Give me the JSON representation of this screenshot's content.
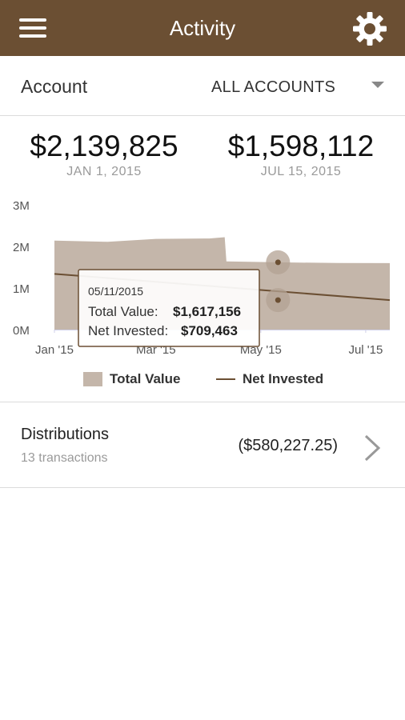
{
  "app_bar": {
    "title": "Activity",
    "menu_icon": "hamburger-menu-icon",
    "settings_icon": "gear-icon",
    "color": "#6b4f33"
  },
  "account": {
    "label": "Account",
    "selected": "ALL ACCOUNTS"
  },
  "summary": {
    "start": {
      "value": "$2,139,825",
      "date": "JAN 1, 2015"
    },
    "end": {
      "value": "$1,598,112",
      "date": "JUL 15, 2015"
    }
  },
  "chart_data": {
    "type": "area",
    "y_ticks": [
      "3M",
      "2M",
      "1M",
      "0M"
    ],
    "x_ticks": [
      "Jan '15",
      "Mar '15",
      "May '15",
      "Jul '15"
    ],
    "ylim": [
      0,
      3000000
    ],
    "series": [
      {
        "name": "Total Value",
        "kind": "area",
        "color": "#c4b6aa",
        "x": [
          "2015-01-01",
          "2015-02-01",
          "2015-03-01",
          "2015-04-01",
          "2015-04-10",
          "2015-04-11",
          "2015-05-11",
          "2015-06-15",
          "2015-07-15"
        ],
        "values": [
          2139825,
          2110000,
          2180000,
          2190000,
          2220000,
          1640000,
          1617156,
          1600000,
          1598112
        ]
      },
      {
        "name": "Net Invested",
        "kind": "line",
        "color": "#6b4f33",
        "x": [
          "2015-01-01",
          "2015-07-15"
        ],
        "values": [
          1340000,
          709463
        ]
      }
    ],
    "tooltip": {
      "date": "05/11/2015",
      "total_label": "Total Value:",
      "total_value": "$1,617,156",
      "invested_label": "Net Invested:",
      "invested_value": "$709,463"
    },
    "legend": {
      "total": "Total Value",
      "invested": "Net Invested"
    },
    "grid": false
  },
  "distributions": {
    "title": "Distributions",
    "subtitle": "13 transactions",
    "amount": "($580,227.25)",
    "chevron_icon": "chevron-right-icon"
  }
}
